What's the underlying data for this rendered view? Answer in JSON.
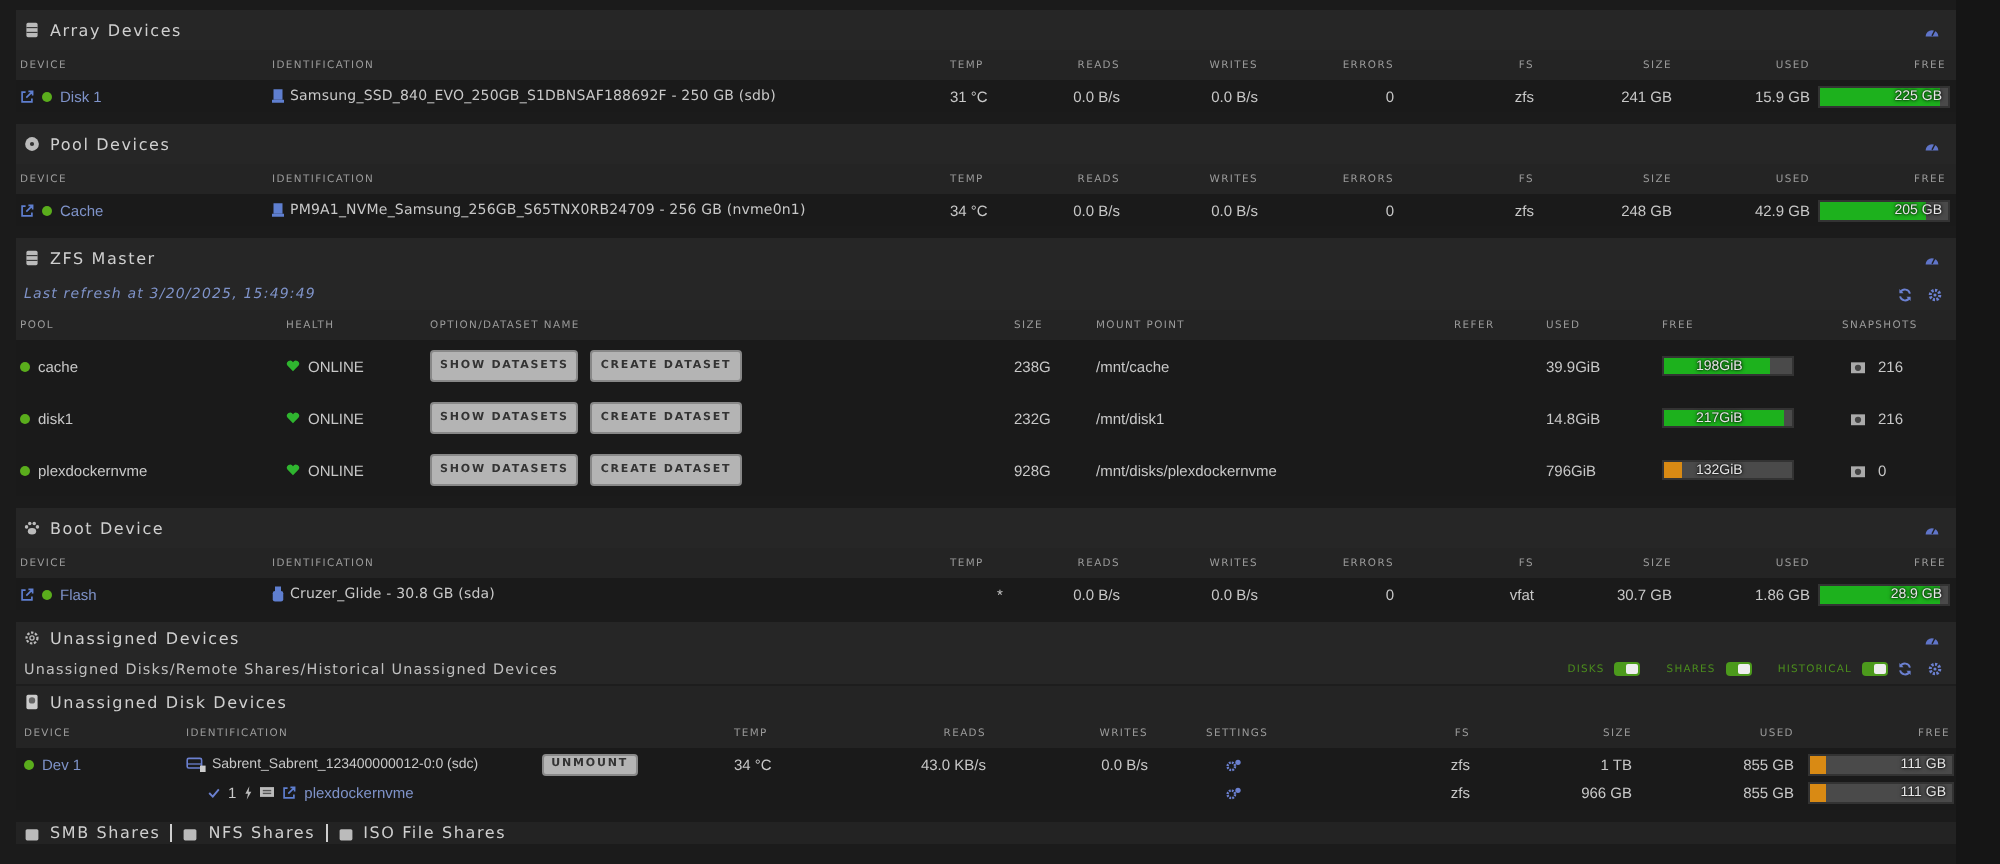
{
  "array_devices": {
    "title": "Array Devices",
    "columns": [
      "DEVICE",
      "IDENTIFICATION",
      "TEMP",
      "READS",
      "WRITES",
      "ERRORS",
      "FS",
      "SIZE",
      "USED",
      "FREE"
    ],
    "rows": [
      {
        "device": "Disk 1",
        "identification": "Samsung_SSD_840_EVO_250GB_S1DBNSAF188692F - 250 GB (sdb)",
        "temp": "31 °C",
        "reads": "0.0 B/s",
        "writes": "0.0 B/s",
        "errors": "0",
        "fs": "zfs",
        "size": "241 GB",
        "used": "15.9 GB",
        "free": "225 GB",
        "level": 0.93
      }
    ]
  },
  "pool_devices": {
    "title": "Pool Devices",
    "columns": [
      "DEVICE",
      "IDENTIFICATION",
      "TEMP",
      "READS",
      "WRITES",
      "ERRORS",
      "FS",
      "SIZE",
      "USED",
      "FREE"
    ],
    "rows": [
      {
        "device": "Cache",
        "identification": "PM9A1_NVMe_Samsung_256GB_S65TNX0RB24709 - 256 GB (nvme0n1)",
        "temp": "34 °C",
        "reads": "0.0 B/s",
        "writes": "0.0 B/s",
        "errors": "0",
        "fs": "zfs",
        "size": "248 GB",
        "used": "42.9 GB",
        "free": "205 GB",
        "level": 0.83
      }
    ]
  },
  "zfs_master": {
    "title": "ZFS Master",
    "refresh_note": "Last refresh at 3/20/2025, 15:49:49",
    "columns": [
      "POOL",
      "HEALTH",
      "OPTION/DATASET NAME",
      "SIZE",
      "MOUNT POINT",
      "REFER",
      "USED",
      "FREE",
      "SNAPSHOTS"
    ],
    "pools": [
      {
        "name": "cache",
        "health": "ONLINE",
        "buttons": [
          "SHOW DATASETS",
          "CREATE DATASET"
        ],
        "size": "238G",
        "mount_point": "/mnt/cache",
        "used": "39.9GiB",
        "free": "198GiB",
        "level": 0.83,
        "snapshots": "216"
      },
      {
        "name": "disk1",
        "health": "ONLINE",
        "buttons": [
          "SHOW DATASETS",
          "CREATE DATASET"
        ],
        "size": "232G",
        "mount_point": "/mnt/disk1",
        "used": "14.8GiB",
        "free": "217GiB",
        "level": 0.94,
        "snapshots": "216"
      },
      {
        "name": "plexdockernvme",
        "health": "ONLINE",
        "buttons": [
          "SHOW DATASETS",
          "CREATE DATASET"
        ],
        "size": "928G",
        "mount_point": "/mnt/disks/plexdockernvme",
        "used": "796GiB",
        "free": "132GiB",
        "level": 0.14,
        "snapshots": "0"
      }
    ]
  },
  "boot_device": {
    "title": "Boot Device",
    "columns": [
      "DEVICE",
      "IDENTIFICATION",
      "TEMP",
      "READS",
      "WRITES",
      "ERRORS",
      "FS",
      "SIZE",
      "USED",
      "FREE"
    ],
    "rows": [
      {
        "device": "Flash",
        "identification": "Cruzer_Glide - 30.8 GB (sda)",
        "temp": "*",
        "reads": "0.0 B/s",
        "writes": "0.0 B/s",
        "errors": "0",
        "fs": "vfat",
        "size": "30.7 GB",
        "used": "1.86 GB",
        "free": "28.9 GB",
        "level": 0.94
      }
    ]
  },
  "unassigned_devices": {
    "title": "Unassigned Devices",
    "subtitle": "Unassigned Disks/Remote Shares/Historical Unassigned Devices",
    "toggles": [
      {
        "label": "DISKS",
        "on": true
      },
      {
        "label": "SHARES",
        "on": true
      },
      {
        "label": "HISTORICAL",
        "on": true
      }
    ],
    "disk_devices": {
      "title": "Unassigned Disk Devices",
      "columns": [
        "DEVICE",
        "IDENTIFICATION",
        "TEMP",
        "READS",
        "WRITES",
        "SETTINGS",
        "FS",
        "SIZE",
        "USED",
        "FREE"
      ],
      "rows": [
        {
          "device": "Dev 1",
          "identification": "Sabrent_Sabrent_123400000012-0:0 (sdc)",
          "button": "UNMOUNT",
          "temp": "34 °C",
          "reads": "43.0 KB/s",
          "writes": "0.0 B/s",
          "fs": "zfs",
          "size": "1 TB",
          "used": "855 GB",
          "free": "111 GB",
          "level": 0.11,
          "partitions": [
            {
              "number": "1",
              "mounted": true,
              "link": "plexdockernvme",
              "fs": "zfs",
              "size": "966 GB",
              "used": "855 GB",
              "free": "111 GB",
              "level": 0.11
            }
          ]
        }
      ]
    }
  },
  "share_tabs": [
    "SMB Shares",
    "NFS Shares",
    "ISO File Shares"
  ]
}
